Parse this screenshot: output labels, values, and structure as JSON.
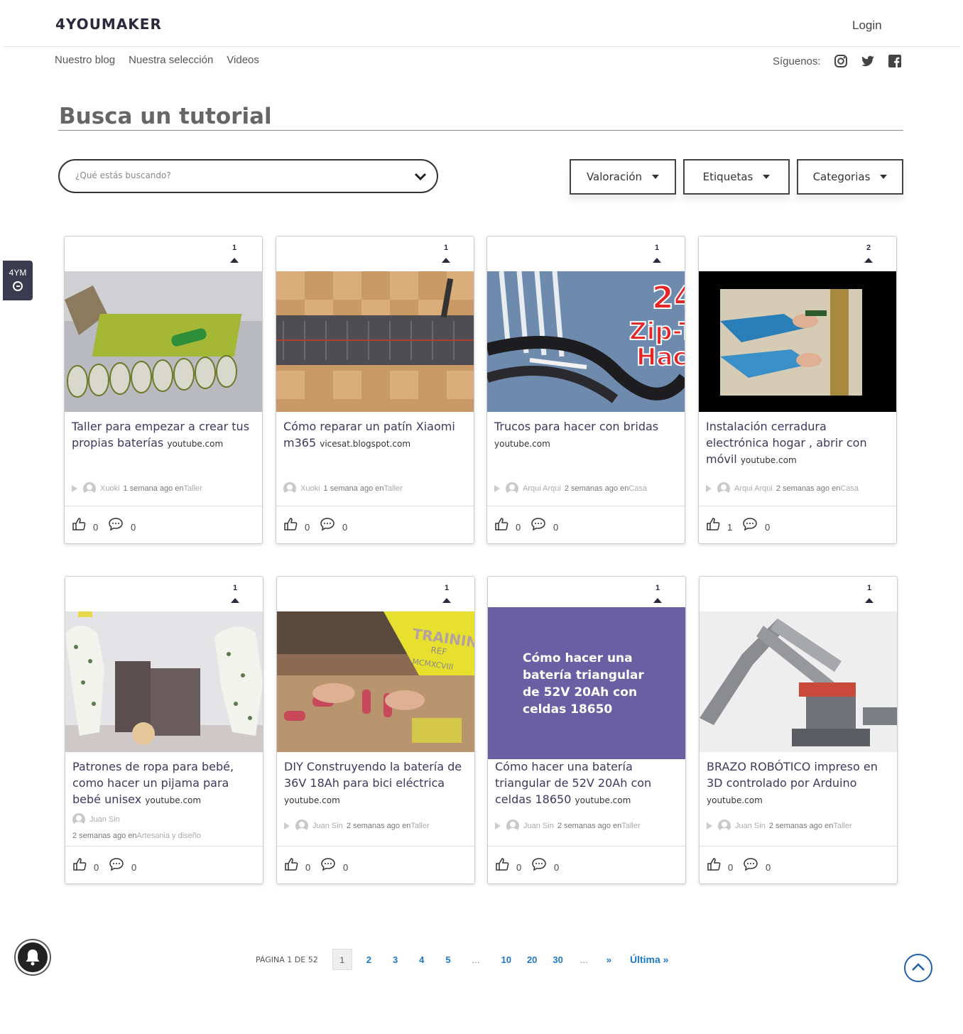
{
  "header": {
    "logo": "4YOUMAKER",
    "login": "Login"
  },
  "nav": [
    "Nuestro blog",
    "Nuestra selección",
    "Videos"
  ],
  "social": {
    "label": "Síguenos:",
    "icons": [
      "instagram-icon",
      "twitter-icon",
      "facebook-icon"
    ]
  },
  "section_title": "Busca un tutorial",
  "search": {
    "placeholder": "¿Qué estás buscando?"
  },
  "filters": [
    "Valoración",
    "Etiquetas",
    "Categorias"
  ],
  "side_tab": "4YM",
  "cards": [
    {
      "votes": "1",
      "title": "Taller para empezar a crear tus propias baterías",
      "source": "youtube.com",
      "author": "Xuoki",
      "time": "1 semana ago en",
      "category": "Taller",
      "likes": "0",
      "comments": "0"
    },
    {
      "votes": "1",
      "title": "Cómo reparar un patín Xiaomi m365",
      "source": "vicesat.blogspot.com",
      "author": "Xuoki",
      "time": "1 semana ago en",
      "category": "Taller",
      "likes": "0",
      "comments": "0"
    },
    {
      "votes": "1",
      "title": "Trucos para hacer con bridas",
      "source": "youtube.com",
      "author": "Arqui Arqui",
      "time": "2 semanas ago en",
      "category": "Casa",
      "likes": "0",
      "comments": "0",
      "image_text": [
        "24",
        "Zip-T",
        "Hack"
      ]
    },
    {
      "votes": "2",
      "title": "Instalación cerradura electrónica hogar , abrir con móvil",
      "source": "youtube.com",
      "author": "Arqui Arqui",
      "time": "2 semanas ago en",
      "category": "Casa",
      "likes": "1",
      "comments": "0"
    },
    {
      "votes": "1",
      "title": "Patrones de ropa para bebé, como hacer un pijama para bebé unisex",
      "source": "youtube.com",
      "author": "Juan Sin",
      "time": "2 semanas ago en",
      "category": "Artesania y diseño",
      "likes": "0",
      "comments": "0"
    },
    {
      "votes": "1",
      "title": "DIY Construyendo la batería de 36V 18Ah para bici eléctrica",
      "source": "youtube.com",
      "author": "Juan Sin",
      "time": "2 semanas ago en",
      "category": "Taller",
      "likes": "0",
      "comments": "0",
      "image_text": [
        "TRAININ",
        "REF",
        "MCMXCVIII"
      ]
    },
    {
      "votes": "1",
      "title": "Cómo hacer una batería triangular de 52V 20Ah con celdas 18650",
      "source": "youtube.com",
      "author": "Juan Sin",
      "time": "2 semanas ago en",
      "category": "Taller",
      "likes": "0",
      "comments": "0",
      "image_text": [
        "Cómo hacer una",
        "batería triangular",
        "de 52V 20Ah con",
        "celdas 18650"
      ]
    },
    {
      "votes": "1",
      "title": "BRAZO ROBÓTICO impreso en 3D controlado por Arduino",
      "source": "youtube.com",
      "author": "Juan Sin",
      "time": "2 semanas ago en",
      "category": "Taller",
      "likes": "0",
      "comments": "0"
    }
  ],
  "pagination": {
    "info": "PÁGINA 1 DE 52",
    "pages": [
      "1",
      "2",
      "3",
      "4",
      "5",
      "...",
      "10",
      "20",
      "30",
      "...",
      "»",
      "Última »"
    ],
    "current": "1"
  },
  "colors": {
    "accent": "#3e3760",
    "link": "#1f78c5",
    "promo": "#6b5fa3"
  }
}
